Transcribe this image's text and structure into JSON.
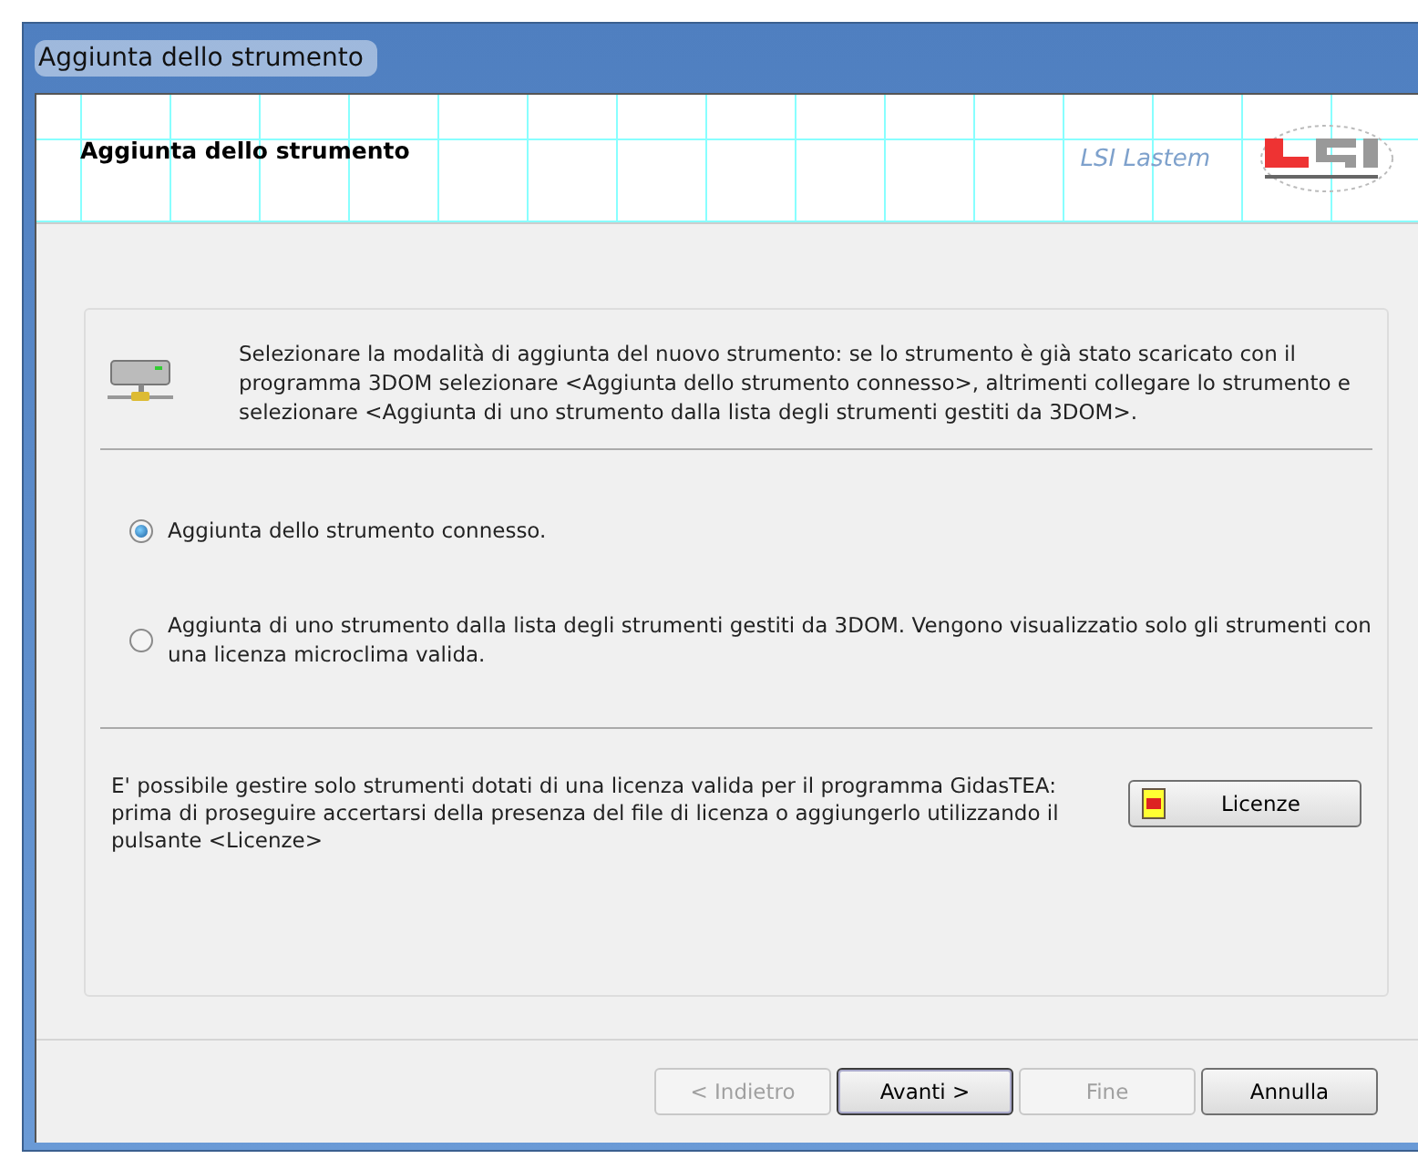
{
  "window": {
    "title": "Aggiunta dello strumento"
  },
  "header": {
    "title": "Aggiunta dello strumento",
    "brand": "LSI Lastem"
  },
  "intro": {
    "text": "Selezionare la modalità di aggiunta del nuovo strumento: se lo strumento è già stato scaricato con il programma 3DOM selezionare <Aggiunta dello strumento connesso>, altrimenti collegare lo strumento e selezionare <Aggiunta di uno strumento dalla lista degli strumenti gestiti da 3DOM>."
  },
  "options": [
    {
      "label": "Aggiunta dello strumento connesso.",
      "selected": true
    },
    {
      "label": "Aggiunta di uno strumento dalla lista degli strumenti gestiti da 3DOM. Vengono visualizzatio solo gli strumenti con una licenza microclima valida.",
      "selected": false
    }
  ],
  "license": {
    "text": "E' possibile gestire solo strumenti dotati di una licenza valida per il programma GidasTEA: prima di proseguire accertarsi della presenza del file di licenza o aggiungerlo utilizzando il pulsante <Licenze>",
    "button": "Licenze"
  },
  "buttons": [
    {
      "label": "< Indietro",
      "disabled": true,
      "default": false
    },
    {
      "label": "Avanti >",
      "disabled": false,
      "default": true
    },
    {
      "label": "Fine",
      "disabled": true,
      "default": false
    },
    {
      "label": "Annulla",
      "disabled": false,
      "default": false
    }
  ]
}
